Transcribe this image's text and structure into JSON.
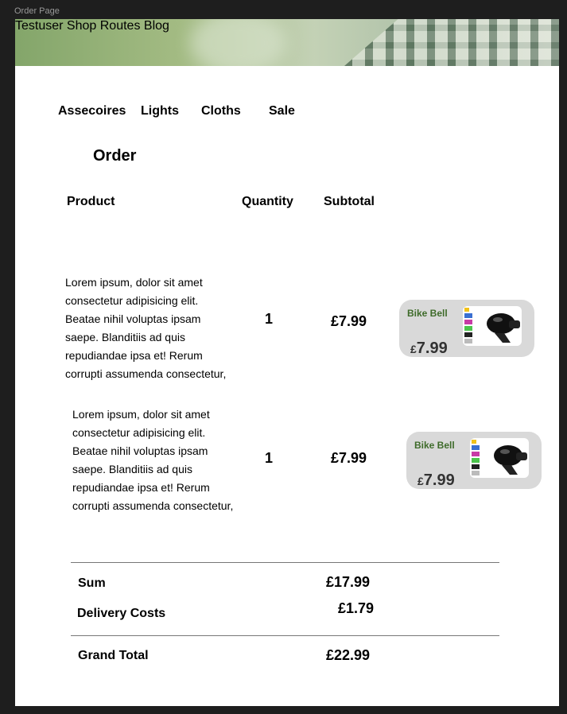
{
  "frame_label": "Order Page",
  "nav": {
    "items": [
      "Testuser",
      "Shop",
      "Routes",
      "Blog"
    ]
  },
  "categories": [
    "Assecoires",
    "Lights",
    "Cloths",
    "Sale"
  ],
  "order": {
    "title": "Order",
    "headers": {
      "product": "Product",
      "quantity": "Quantity",
      "subtotal": "Subtotal"
    },
    "items": [
      {
        "description": "Lorem ipsum, dolor sit amet consectetur adipisicing elit. Beatae nihil voluptas ipsam saepe. Blanditiis ad quis repudiandae ipsa et! Rerum corrupti assumenda consectetur,",
        "quantity": "1",
        "subtotal": "£7.99",
        "card": {
          "name": "Bike Bell",
          "currency": "£",
          "price": "7.99",
          "icon": "bike-bell-image"
        }
      },
      {
        "description": "Lorem ipsum, dolor sit amet consectetur adipisicing elit. Beatae nihil voluptas ipsam saepe. Blanditiis ad quis repudiandae ipsa et! Rerum corrupti assumenda consectetur,",
        "quantity": "1",
        "subtotal": "£7.99",
        "card": {
          "name": "Bike Bell",
          "currency": "£",
          "price": "7.99",
          "icon": "bike-bell-image"
        }
      }
    ]
  },
  "totals": {
    "sum_label": "Sum",
    "sum_value": "£17.99",
    "delivery_label": "Delivery Costs",
    "delivery_value": "£1.79",
    "grand_label": "Grand Total",
    "grand_value": "£22.99"
  },
  "colors": {
    "card_bg": "#d9d9d9",
    "card_name": "#3e6b2a",
    "page_bg": "#ffffff",
    "frame_bg": "#1e1e1e"
  }
}
